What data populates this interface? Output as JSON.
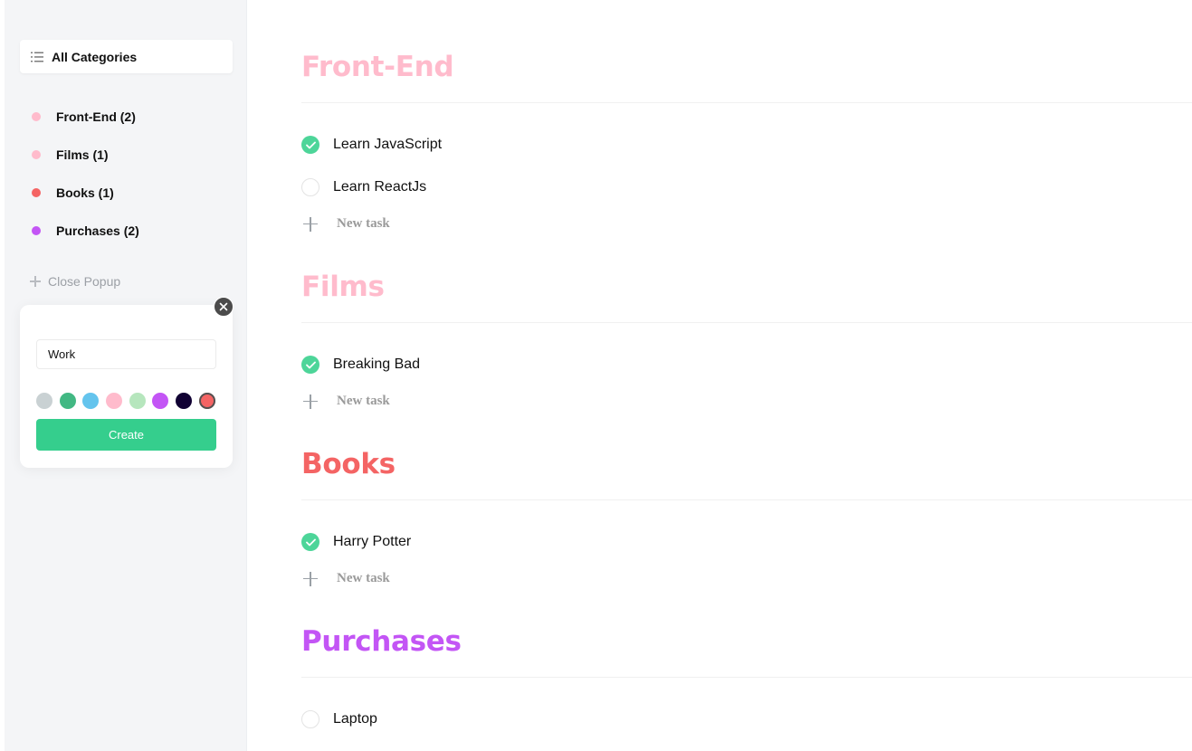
{
  "sidebar": {
    "all_label": "All Categories",
    "categories": [
      {
        "label": "Front-End (2)",
        "color": "#ffbbcc"
      },
      {
        "label": "Films (1)",
        "color": "#ffbbcc"
      },
      {
        "label": "Books (1)",
        "color": "#f46464"
      },
      {
        "label": "Purchases (2)",
        "color": "#c355f5"
      }
    ],
    "close_popup_label": "Close Popup"
  },
  "popup": {
    "input_value": "Work",
    "swatches": [
      {
        "name": "grey",
        "color": "#c9d1d3"
      },
      {
        "name": "green",
        "color": "#42b883"
      },
      {
        "name": "blue",
        "color": "#64c4ed"
      },
      {
        "name": "pink",
        "color": "#ffbbcc"
      },
      {
        "name": "lime",
        "color": "#b6e6bd"
      },
      {
        "name": "purple",
        "color": "#c355f5"
      },
      {
        "name": "black",
        "color": "#110133"
      },
      {
        "name": "red",
        "color": "#f46464",
        "selected": true
      }
    ],
    "create_label": "Create"
  },
  "lists": [
    {
      "title": "Front-End",
      "color": "#ffbbcc",
      "tasks": [
        {
          "text": "Learn JavaScript",
          "done": true
        },
        {
          "text": "Learn ReactJs",
          "done": false
        }
      ],
      "new_task_label": "New task"
    },
    {
      "title": "Films",
      "color": "#ffbbcc",
      "tasks": [
        {
          "text": "Breaking Bad",
          "done": true
        }
      ],
      "new_task_label": "New task"
    },
    {
      "title": "Books",
      "color": "#f46464",
      "tasks": [
        {
          "text": "Harry Potter",
          "done": true
        }
      ],
      "new_task_label": "New task"
    },
    {
      "title": "Purchases",
      "color": "#c355f5",
      "tasks": [
        {
          "text": "Laptop",
          "done": false
        }
      ]
    }
  ],
  "colors": {
    "check_done": "#4dd599",
    "create_button": "#35ce8d"
  }
}
